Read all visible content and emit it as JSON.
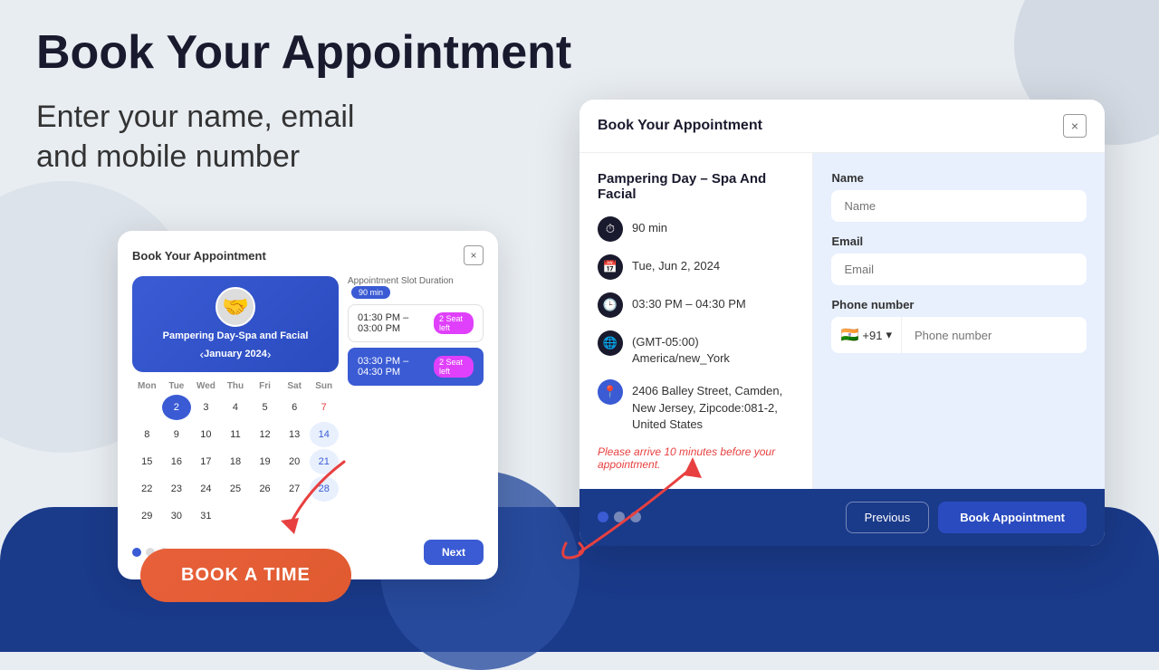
{
  "page": {
    "background_color": "#e8edf2"
  },
  "left_section": {
    "main_title": "Book Your Appointment",
    "sub_title": "Enter your name, email\nand mobile number",
    "book_button": "BOOK A TIME"
  },
  "small_modal": {
    "title": "Book Your Appointment",
    "close_label": "×",
    "service_name": "Pampering Day-Spa and Facial",
    "calendar_month": "January 2024",
    "day_names": [
      "Mon",
      "Tue",
      "Wed",
      "Thu",
      "Fri",
      "Sat",
      "Sun"
    ],
    "weeks": [
      [
        "",
        "",
        "",
        "",
        "",
        "",
        "7"
      ],
      [
        "8",
        "9",
        "10",
        "11",
        "12",
        "13",
        "14"
      ],
      [
        "15",
        "16",
        "17",
        "18",
        "19",
        "20",
        "21"
      ],
      [
        "22",
        "23",
        "24",
        "25",
        "26",
        "27",
        "28"
      ],
      [
        "29",
        "30",
        "31",
        "",
        "",
        "",
        ""
      ]
    ],
    "special_dates": {
      "selected": "2",
      "highlighted1": "14",
      "highlighted2": "21",
      "highlighted3": "28"
    },
    "slot_duration_label": "Appointment Slot Duration",
    "duration_badge": "90 min",
    "slots": [
      {
        "time": "01:30 PM – 03:00 PM",
        "badge": "2 Seat left",
        "active": false
      },
      {
        "time": "03:30 PM – 04:30 PM",
        "badge": "2 Seat left",
        "active": true
      }
    ],
    "dots": [
      true,
      false,
      false
    ],
    "next_label": "Next"
  },
  "large_modal": {
    "title": "Book Your Appointment",
    "close_label": "×",
    "service_title": "Pampering Day – Spa And Facial",
    "details": [
      {
        "icon": "⏱",
        "text": "90 min"
      },
      {
        "icon": "📅",
        "text": "Tue, Jun 2, 2024"
      },
      {
        "icon": "🕒",
        "text": "03:30 PM – 04:30 PM"
      },
      {
        "icon": "🌐",
        "text": "(GMT-05:00) America/new_York"
      },
      {
        "icon": "📍",
        "text": "2406 Balley Street, Camden, New Jersey, Zipcode:081-2, United States"
      }
    ],
    "notice": "Please arrive 10 minutes before your appointment.",
    "form": {
      "name_label": "Name",
      "name_placeholder": "Name",
      "email_label": "Email",
      "email_placeholder": "Email",
      "phone_label": "Phone number",
      "phone_country_flag": "🇮🇳",
      "phone_code": "+91",
      "phone_placeholder": "Phone number"
    },
    "footer": {
      "dots": [
        true,
        false,
        false
      ],
      "previous_label": "Previous",
      "book_label": "Book Appointment"
    }
  }
}
